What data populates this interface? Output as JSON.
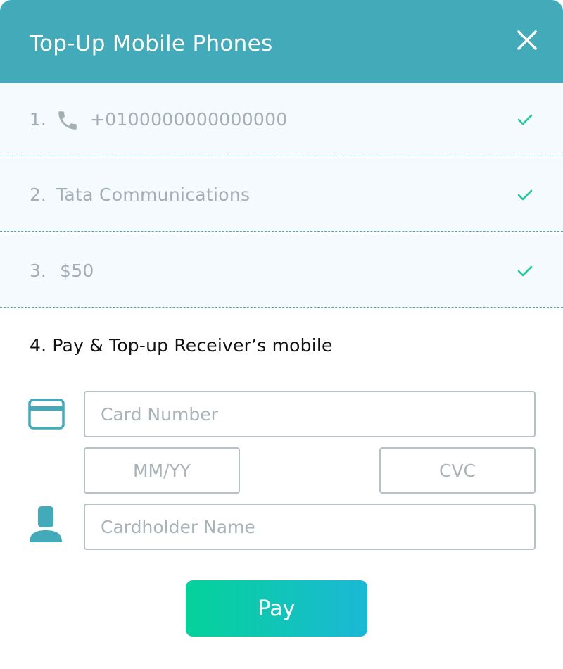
{
  "header": {
    "title": "Top-Up Mobile Phones",
    "close_icon": "close-icon"
  },
  "steps": [
    {
      "number": "1.",
      "text": "+0100000000000000",
      "icon": "phone-icon",
      "completed": true
    },
    {
      "number": "2.",
      "text": "Tata Communications",
      "completed": true
    },
    {
      "number": "3.",
      "text": "$50",
      "completed": true
    }
  ],
  "payment": {
    "title": "4. Pay & Top-up Receiver’s mobile",
    "card_number_placeholder": "Card Number",
    "expiry_placeholder": "MM/YY",
    "cvc_placeholder": "CVC",
    "cardholder_placeholder": "Cardholder Name",
    "card_icon": "credit-card-icon",
    "person_icon": "person-icon",
    "pay_label": "Pay"
  },
  "colors": {
    "header": "#42aab9",
    "step_background": "#f4faff",
    "check": "#1cc99a",
    "muted_text": "#a3afb3",
    "pay_gradient_start": "#05d29a",
    "pay_gradient_end": "#1bb8d6"
  }
}
